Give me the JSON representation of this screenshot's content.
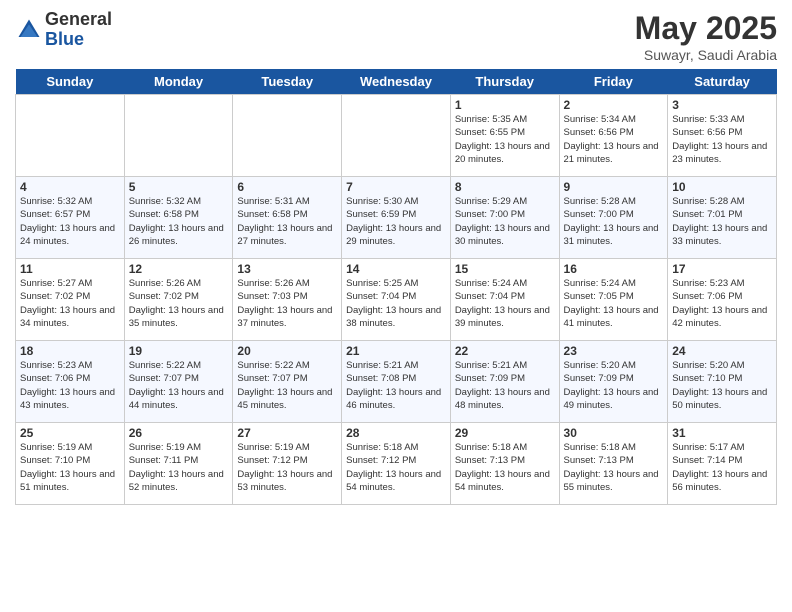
{
  "logo": {
    "general": "General",
    "blue": "Blue"
  },
  "title": "May 2025",
  "subtitle": "Suwayr, Saudi Arabia",
  "days_of_week": [
    "Sunday",
    "Monday",
    "Tuesday",
    "Wednesday",
    "Thursday",
    "Friday",
    "Saturday"
  ],
  "weeks": [
    [
      {
        "day": "",
        "sunrise": "",
        "sunset": "",
        "daylight": ""
      },
      {
        "day": "",
        "sunrise": "",
        "sunset": "",
        "daylight": ""
      },
      {
        "day": "",
        "sunrise": "",
        "sunset": "",
        "daylight": ""
      },
      {
        "day": "",
        "sunrise": "",
        "sunset": "",
        "daylight": ""
      },
      {
        "day": "1",
        "sunrise": "Sunrise: 5:35 AM",
        "sunset": "Sunset: 6:55 PM",
        "daylight": "Daylight: 13 hours and 20 minutes."
      },
      {
        "day": "2",
        "sunrise": "Sunrise: 5:34 AM",
        "sunset": "Sunset: 6:56 PM",
        "daylight": "Daylight: 13 hours and 21 minutes."
      },
      {
        "day": "3",
        "sunrise": "Sunrise: 5:33 AM",
        "sunset": "Sunset: 6:56 PM",
        "daylight": "Daylight: 13 hours and 23 minutes."
      }
    ],
    [
      {
        "day": "4",
        "sunrise": "Sunrise: 5:32 AM",
        "sunset": "Sunset: 6:57 PM",
        "daylight": "Daylight: 13 hours and 24 minutes."
      },
      {
        "day": "5",
        "sunrise": "Sunrise: 5:32 AM",
        "sunset": "Sunset: 6:58 PM",
        "daylight": "Daylight: 13 hours and 26 minutes."
      },
      {
        "day": "6",
        "sunrise": "Sunrise: 5:31 AM",
        "sunset": "Sunset: 6:58 PM",
        "daylight": "Daylight: 13 hours and 27 minutes."
      },
      {
        "day": "7",
        "sunrise": "Sunrise: 5:30 AM",
        "sunset": "Sunset: 6:59 PM",
        "daylight": "Daylight: 13 hours and 29 minutes."
      },
      {
        "day": "8",
        "sunrise": "Sunrise: 5:29 AM",
        "sunset": "Sunset: 7:00 PM",
        "daylight": "Daylight: 13 hours and 30 minutes."
      },
      {
        "day": "9",
        "sunrise": "Sunrise: 5:28 AM",
        "sunset": "Sunset: 7:00 PM",
        "daylight": "Daylight: 13 hours and 31 minutes."
      },
      {
        "day": "10",
        "sunrise": "Sunrise: 5:28 AM",
        "sunset": "Sunset: 7:01 PM",
        "daylight": "Daylight: 13 hours and 33 minutes."
      }
    ],
    [
      {
        "day": "11",
        "sunrise": "Sunrise: 5:27 AM",
        "sunset": "Sunset: 7:02 PM",
        "daylight": "Daylight: 13 hours and 34 minutes."
      },
      {
        "day": "12",
        "sunrise": "Sunrise: 5:26 AM",
        "sunset": "Sunset: 7:02 PM",
        "daylight": "Daylight: 13 hours and 35 minutes."
      },
      {
        "day": "13",
        "sunrise": "Sunrise: 5:26 AM",
        "sunset": "Sunset: 7:03 PM",
        "daylight": "Daylight: 13 hours and 37 minutes."
      },
      {
        "day": "14",
        "sunrise": "Sunrise: 5:25 AM",
        "sunset": "Sunset: 7:04 PM",
        "daylight": "Daylight: 13 hours and 38 minutes."
      },
      {
        "day": "15",
        "sunrise": "Sunrise: 5:24 AM",
        "sunset": "Sunset: 7:04 PM",
        "daylight": "Daylight: 13 hours and 39 minutes."
      },
      {
        "day": "16",
        "sunrise": "Sunrise: 5:24 AM",
        "sunset": "Sunset: 7:05 PM",
        "daylight": "Daylight: 13 hours and 41 minutes."
      },
      {
        "day": "17",
        "sunrise": "Sunrise: 5:23 AM",
        "sunset": "Sunset: 7:06 PM",
        "daylight": "Daylight: 13 hours and 42 minutes."
      }
    ],
    [
      {
        "day": "18",
        "sunrise": "Sunrise: 5:23 AM",
        "sunset": "Sunset: 7:06 PM",
        "daylight": "Daylight: 13 hours and 43 minutes."
      },
      {
        "day": "19",
        "sunrise": "Sunrise: 5:22 AM",
        "sunset": "Sunset: 7:07 PM",
        "daylight": "Daylight: 13 hours and 44 minutes."
      },
      {
        "day": "20",
        "sunrise": "Sunrise: 5:22 AM",
        "sunset": "Sunset: 7:07 PM",
        "daylight": "Daylight: 13 hours and 45 minutes."
      },
      {
        "day": "21",
        "sunrise": "Sunrise: 5:21 AM",
        "sunset": "Sunset: 7:08 PM",
        "daylight": "Daylight: 13 hours and 46 minutes."
      },
      {
        "day": "22",
        "sunrise": "Sunrise: 5:21 AM",
        "sunset": "Sunset: 7:09 PM",
        "daylight": "Daylight: 13 hours and 48 minutes."
      },
      {
        "day": "23",
        "sunrise": "Sunrise: 5:20 AM",
        "sunset": "Sunset: 7:09 PM",
        "daylight": "Daylight: 13 hours and 49 minutes."
      },
      {
        "day": "24",
        "sunrise": "Sunrise: 5:20 AM",
        "sunset": "Sunset: 7:10 PM",
        "daylight": "Daylight: 13 hours and 50 minutes."
      }
    ],
    [
      {
        "day": "25",
        "sunrise": "Sunrise: 5:19 AM",
        "sunset": "Sunset: 7:10 PM",
        "daylight": "Daylight: 13 hours and 51 minutes."
      },
      {
        "day": "26",
        "sunrise": "Sunrise: 5:19 AM",
        "sunset": "Sunset: 7:11 PM",
        "daylight": "Daylight: 13 hours and 52 minutes."
      },
      {
        "day": "27",
        "sunrise": "Sunrise: 5:19 AM",
        "sunset": "Sunset: 7:12 PM",
        "daylight": "Daylight: 13 hours and 53 minutes."
      },
      {
        "day": "28",
        "sunrise": "Sunrise: 5:18 AM",
        "sunset": "Sunset: 7:12 PM",
        "daylight": "Daylight: 13 hours and 54 minutes."
      },
      {
        "day": "29",
        "sunrise": "Sunrise: 5:18 AM",
        "sunset": "Sunset: 7:13 PM",
        "daylight": "Daylight: 13 hours and 54 minutes."
      },
      {
        "day": "30",
        "sunrise": "Sunrise: 5:18 AM",
        "sunset": "Sunset: 7:13 PM",
        "daylight": "Daylight: 13 hours and 55 minutes."
      },
      {
        "day": "31",
        "sunrise": "Sunrise: 5:17 AM",
        "sunset": "Sunset: 7:14 PM",
        "daylight": "Daylight: 13 hours and 56 minutes."
      }
    ]
  ]
}
